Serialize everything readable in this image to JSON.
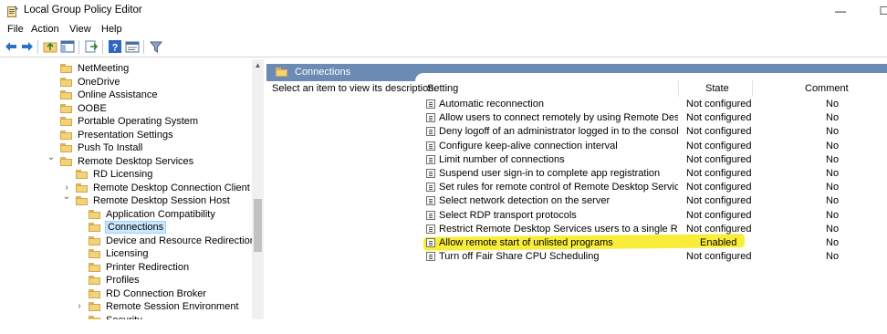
{
  "window": {
    "title": "Local Group Policy Editor",
    "minimize_glyph": "—",
    "maximize_glyph": "☐"
  },
  "menu": [
    "File",
    "Action",
    "View",
    "Help"
  ],
  "toolbar": [
    "back-arrow-icon",
    "forward-arrow-icon",
    "up-folder-icon",
    "show-hide-tree-icon",
    "export-list-icon",
    "help-icon",
    "properties-icon",
    "filter-icon"
  ],
  "tree": {
    "items": [
      {
        "label": "NetMeeting",
        "indent": 0,
        "chevron": ""
      },
      {
        "label": "OneDrive",
        "indent": 0,
        "chevron": ""
      },
      {
        "label": "Online Assistance",
        "indent": 0,
        "chevron": ""
      },
      {
        "label": "OOBE",
        "indent": 0,
        "chevron": ""
      },
      {
        "label": "Portable Operating System",
        "indent": 0,
        "chevron": ""
      },
      {
        "label": "Presentation Settings",
        "indent": 0,
        "chevron": ""
      },
      {
        "label": "Push To Install",
        "indent": 0,
        "chevron": ""
      },
      {
        "label": "Remote Desktop Services",
        "indent": 0,
        "chevron": "expanded"
      },
      {
        "label": "RD Licensing",
        "indent": 1,
        "chevron": ""
      },
      {
        "label": "Remote Desktop Connection Client",
        "indent": 1,
        "chevron": "collapsed"
      },
      {
        "label": "Remote Desktop Session Host",
        "indent": 1,
        "chevron": "expanded"
      },
      {
        "label": "Application Compatibility",
        "indent": 2,
        "chevron": ""
      },
      {
        "label": "Connections",
        "indent": 2,
        "chevron": "",
        "selected": true
      },
      {
        "label": "Device and Resource Redirection",
        "indent": 2,
        "chevron": ""
      },
      {
        "label": "Licensing",
        "indent": 2,
        "chevron": ""
      },
      {
        "label": "Printer Redirection",
        "indent": 2,
        "chevron": ""
      },
      {
        "label": "Profiles",
        "indent": 2,
        "chevron": ""
      },
      {
        "label": "RD Connection Broker",
        "indent": 2,
        "chevron": ""
      },
      {
        "label": "Remote Session Environment",
        "indent": 2,
        "chevron": "collapsed"
      },
      {
        "label": "Security",
        "indent": 2,
        "chevron": ""
      }
    ]
  },
  "right": {
    "header_title": "Connections",
    "description": "Select an item to view its description.",
    "columns": {
      "setting": "Setting",
      "state": "State",
      "comment": "Comment"
    },
    "rows": [
      {
        "setting": "Automatic reconnection",
        "state": "Not configured",
        "comment": "No"
      },
      {
        "setting": "Allow users to connect remotely by using Remote Desktop S...",
        "state": "Not configured",
        "comment": "No"
      },
      {
        "setting": "Deny logoff of an administrator logged in to the console ses...",
        "state": "Not configured",
        "comment": "No"
      },
      {
        "setting": "Configure keep-alive connection interval",
        "state": "Not configured",
        "comment": "No"
      },
      {
        "setting": "Limit number of connections",
        "state": "Not configured",
        "comment": "No"
      },
      {
        "setting": "Suspend user sign-in to complete app registration",
        "state": "Not configured",
        "comment": "No"
      },
      {
        "setting": "Set rules for remote control of Remote Desktop Services use...",
        "state": "Not configured",
        "comment": "No"
      },
      {
        "setting": "Select network detection on the server",
        "state": "Not configured",
        "comment": "No"
      },
      {
        "setting": "Select RDP transport protocols",
        "state": "Not configured",
        "comment": "No"
      },
      {
        "setting": "Restrict Remote Desktop Services users to a single Remote D...",
        "state": "Not configured",
        "comment": "No"
      },
      {
        "setting": "Allow remote start of unlisted programs",
        "state": "Enabled",
        "comment": "No",
        "highlighted": true
      },
      {
        "setting": "Turn off Fair Share CPU Scheduling",
        "state": "Not configured",
        "comment": "No"
      }
    ]
  },
  "colors": {
    "header_band": "#6b8bb5",
    "highlight": "#f8ee3a",
    "selection": "#cce8ff",
    "folder": "#f2d27a"
  }
}
